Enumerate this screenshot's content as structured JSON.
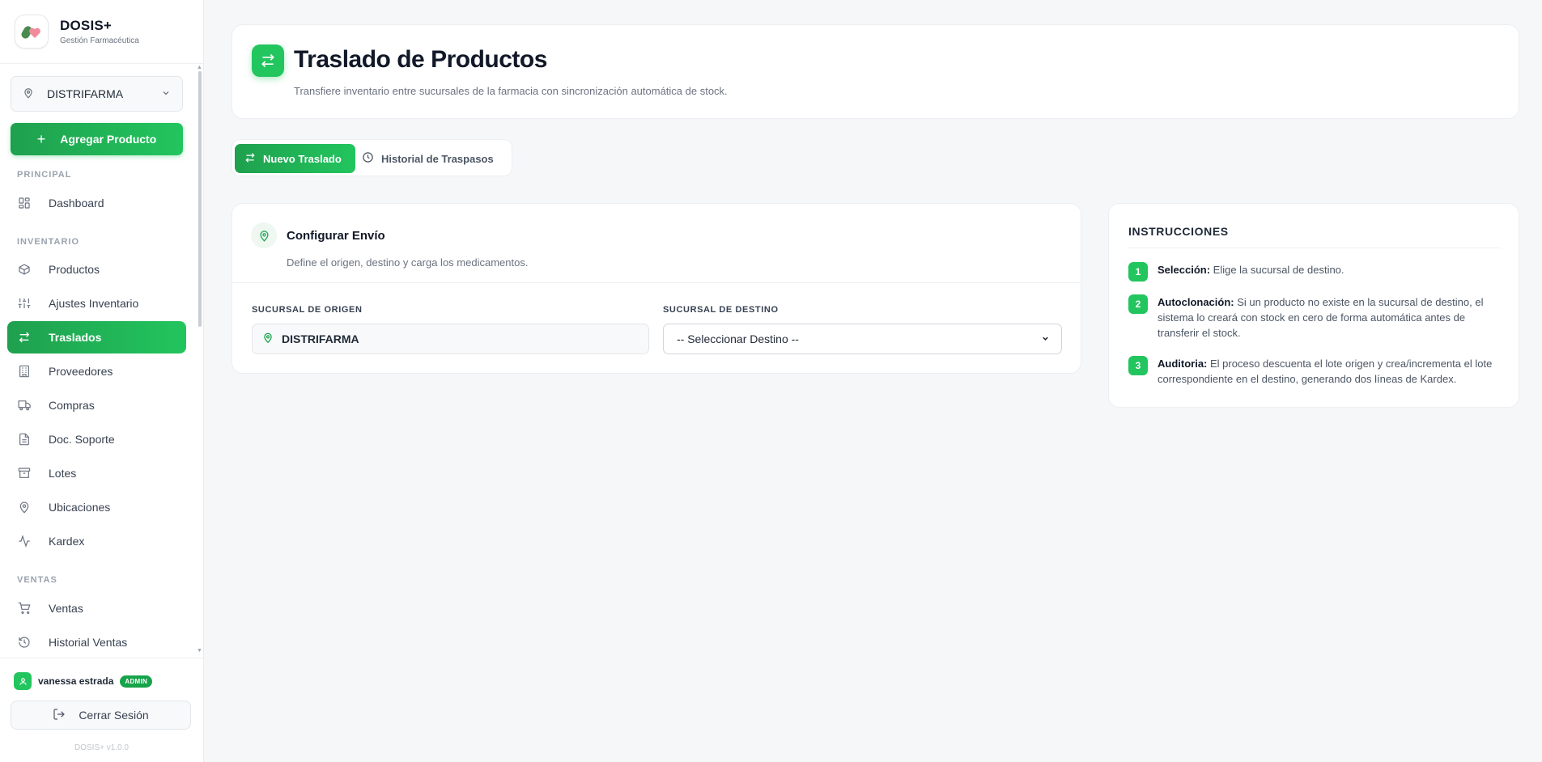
{
  "brand": {
    "name": "DOSIS+",
    "subtitle": "Gestión Farmacéutica"
  },
  "branch_selector": {
    "value": "DISTRIFARMA"
  },
  "add_product_button": "Agregar Producto",
  "nav": {
    "sections": [
      {
        "label": "PRINCIPAL"
      },
      {
        "label": "INVENTARIO"
      },
      {
        "label": "VENTAS"
      }
    ],
    "items": [
      {
        "label": "Dashboard",
        "icon": "dashboard-icon",
        "active": false
      },
      {
        "label": "Productos",
        "icon": "box-icon",
        "active": false
      },
      {
        "label": "Ajustes Inventario",
        "icon": "sliders-icon",
        "active": false
      },
      {
        "label": "Traslados",
        "icon": "transfer-icon",
        "active": true
      },
      {
        "label": "Proveedores",
        "icon": "building-icon",
        "active": false
      },
      {
        "label": "Compras",
        "icon": "truck-icon",
        "active": false
      },
      {
        "label": "Doc. Soporte",
        "icon": "document-icon",
        "active": false
      },
      {
        "label": "Lotes",
        "icon": "archive-icon",
        "active": false
      },
      {
        "label": "Ubicaciones",
        "icon": "map-pin-icon",
        "active": false
      },
      {
        "label": "Kardex",
        "icon": "activity-icon",
        "active": false
      },
      {
        "label": "Ventas",
        "icon": "cart-icon",
        "active": false
      },
      {
        "label": "Historial Ventas",
        "icon": "history-icon",
        "active": false
      }
    ]
  },
  "user": {
    "name": "vanessa estrada",
    "role": "ADMIN"
  },
  "logout_button": "Cerrar Sesión",
  "version": "DOSIS+ v1.0.0",
  "header": {
    "title": "Traslado de Productos",
    "subtitle": "Transfiere inventario entre sucursales de la farmacia con sincronización automática de stock."
  },
  "tabs": [
    {
      "label": "Nuevo Traslado",
      "active": true
    },
    {
      "label": "Historial de Traspasos",
      "active": false
    }
  ],
  "config": {
    "title": "Configurar Envío",
    "subtitle": "Define el origen, destino y carga los medicamentos.",
    "origin_label": "SUCURSAL DE ORIGEN",
    "origin_value": "DISTRIFARMA",
    "destination_label": "SUCURSAL DE DESTINO",
    "destination_value": "-- Seleccionar Destino --"
  },
  "instructions": {
    "title": "INSTRUCCIONES",
    "steps": [
      {
        "num": "1",
        "title": "Selección:",
        "text": "Elige la sucursal de destino."
      },
      {
        "num": "2",
        "title": "Autoclonación:",
        "text": "Si un producto no existe en la sucursal de destino, el sistema lo creará con stock en cero de forma automática antes de transferir el stock."
      },
      {
        "num": "3",
        "title": "Auditoria:",
        "text": "El proceso descuenta el lote origen y crea/incrementa el lote correspondiente en el destino, generando dos líneas de Kardex."
      }
    ]
  },
  "colors": {
    "accent": "#22c55e",
    "accent_dark": "#1fa04e",
    "background": "#f6f7f9"
  }
}
